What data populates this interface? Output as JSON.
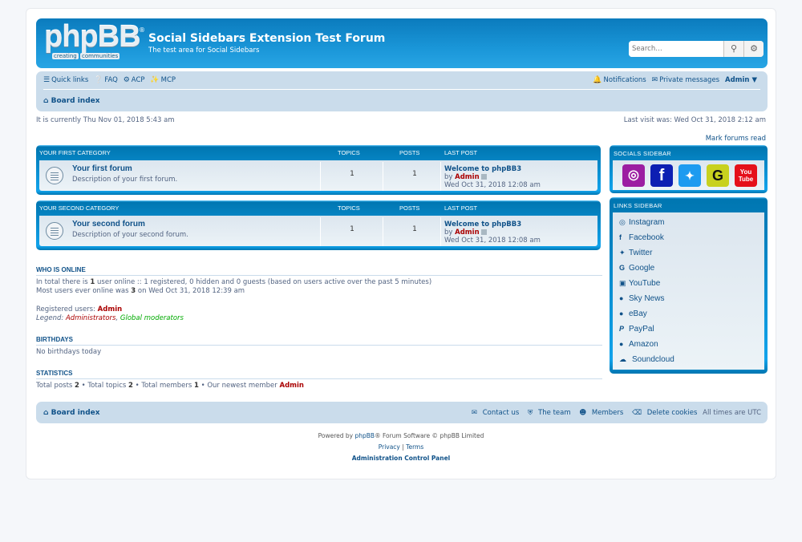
{
  "header": {
    "logo_text": "phpBB",
    "logo_reg": "®",
    "logo_tag1": "creating",
    "logo_tag2": "communities",
    "site_title": "Social Sidebars Extension Test Forum",
    "site_desc": "The test area for Social Sidebars",
    "search_placeholder": "Search…",
    "search_icon": "search-icon",
    "advanced_icon": "gear-icon"
  },
  "navbar": {
    "quick_links": "Quick links",
    "faq": "FAQ",
    "acp": "ACP",
    "mcp": "MCP",
    "notifications": "Notifications",
    "private_messages": "Private messages",
    "user": "Admin",
    "breadcrumb": "Board index"
  },
  "status": {
    "current_time": "It is currently Thu Nov 01, 2018 5:43 am",
    "last_visit": "Last visit was: Wed Oct 31, 2018 2:12 am",
    "mark_read": "Mark forums read"
  },
  "columns": {
    "topics": "TOPICS",
    "posts": "POSTS",
    "last_post": "LAST POST"
  },
  "categories": [
    {
      "name": "YOUR FIRST CATEGORY",
      "forum": {
        "name": "Your first forum",
        "desc": "Description of your first forum.",
        "topics": "1",
        "posts": "1",
        "last_post": {
          "title": "Welcome to phpBB3",
          "by": "by",
          "author": "Admin",
          "time": "Wed Oct 31, 2018 12:08 am"
        }
      }
    },
    {
      "name": "YOUR SECOND CATEGORY",
      "forum": {
        "name": "Your second forum",
        "desc": "Description of your second forum.",
        "topics": "1",
        "posts": "1",
        "last_post": {
          "title": "Welcome to phpBB3",
          "by": "by",
          "author": "Admin",
          "time": "Wed Oct 31, 2018 12:08 am"
        }
      }
    }
  ],
  "socials_sidebar": {
    "title": "SOCIALS SIDEBAR",
    "items": [
      {
        "name": "Instagram",
        "glyph": "◎",
        "color": "#9c1ea2"
      },
      {
        "name": "Facebook",
        "glyph": "f",
        "color": "#0c1fb3"
      },
      {
        "name": "Twitter",
        "glyph": "🐦",
        "color": "#1d9bf0"
      },
      {
        "name": "Google",
        "glyph": "G",
        "color": "#c8d11e"
      },
      {
        "name": "YouTube",
        "glyph": "You Tube",
        "color": "#e5101a"
      }
    ]
  },
  "links_sidebar": {
    "title": "LINKS SIDEBAR",
    "items": [
      {
        "label": "Instagram",
        "icon": "◎"
      },
      {
        "label": "Facebook",
        "icon": "f"
      },
      {
        "label": "Twitter",
        "icon": "✦"
      },
      {
        "label": "Google",
        "icon": "G"
      },
      {
        "label": "YouTube",
        "icon": "▣"
      },
      {
        "label": "Sky News",
        "icon": "●"
      },
      {
        "label": "eBay",
        "icon": "●"
      },
      {
        "label": "PayPal",
        "icon": "P"
      },
      {
        "label": "Amazon",
        "icon": "●"
      },
      {
        "label": "Soundcloud",
        "icon": "☁"
      }
    ]
  },
  "who_is_online": {
    "title": "WHO IS ONLINE",
    "line1_pre": "In total there is ",
    "line1_count": "1",
    "line1_post": " user online :: 1 registered, 0 hidden and 0 guests (based on users active over the past 5 minutes)",
    "line2_pre": "Most users ever online was ",
    "line2_count": "3",
    "line2_post": " on Wed Oct 31, 2018 12:39 am",
    "registered_label": "Registered users: ",
    "registered_user": "Admin",
    "legend_label": "Legend: ",
    "legend_admins": "Administrators",
    "legend_sep": ", ",
    "legend_mods": "Global moderators"
  },
  "birthdays": {
    "title": "BIRTHDAYS",
    "text": "No birthdays today"
  },
  "statistics": {
    "title": "STATISTICS",
    "posts_label": "Total posts ",
    "posts": "2",
    "topics_label": " • Total topics ",
    "topics": "2",
    "members_label": " • Total members ",
    "members": "1",
    "newest_label": " • Our newest member ",
    "newest": "Admin"
  },
  "footer_nav": {
    "board_index": "Board index",
    "contact": "Contact us",
    "team": "The team",
    "members": "Members",
    "delete_cookies": "Delete cookies",
    "timezone": "All times are UTC"
  },
  "copyright": {
    "powered_pre": "Powered by ",
    "phpbb": "phpBB",
    "powered_post": "® Forum Software © phpBB Limited",
    "privacy": "Privacy",
    "sep": " | ",
    "terms": "Terms",
    "acp": "Administration Control Panel"
  },
  "colors": {
    "accent": "#105289",
    "header_blue": "#1a96d8",
    "nav_bg": "#cadceb",
    "admin_red": "#aa0000",
    "moderator_green": "#00aa00"
  }
}
